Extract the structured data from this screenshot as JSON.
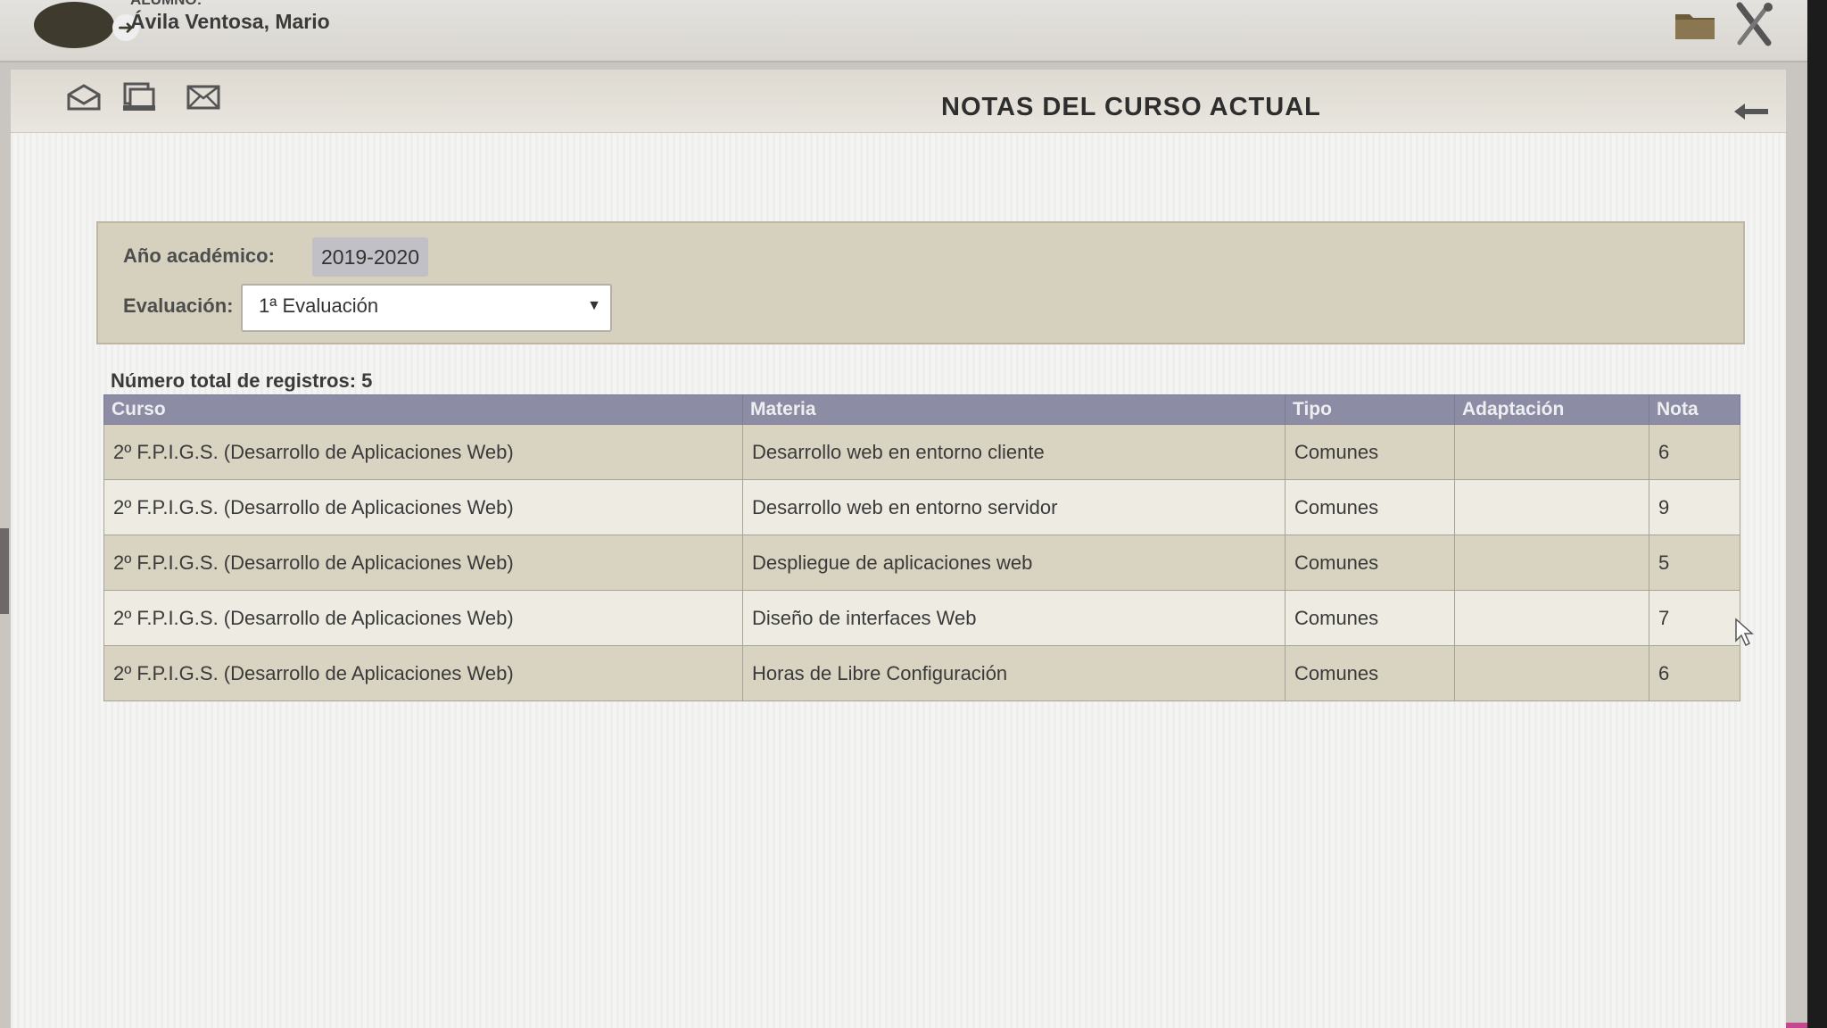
{
  "user": {
    "label": "ALUMNO:",
    "name": "Ávila Ventosa, Mario"
  },
  "header": {
    "title": "NOTAS DEL CURSO ACTUAL"
  },
  "filters": {
    "year_label": "Año académico:",
    "year_value": "2019-2020",
    "eval_label": "Evaluación:",
    "eval_value": "1ª Evaluación"
  },
  "records": {
    "count_label": "Número total de registros: 5"
  },
  "table": {
    "headers": [
      "Curso",
      "Materia",
      "Tipo",
      "Adaptación",
      "Nota"
    ],
    "rows": [
      {
        "curso": "2º F.P.I.G.S. (Desarrollo de Aplicaciones Web)",
        "materia": "Desarrollo web en entorno cliente",
        "tipo": "Comunes",
        "adaptacion": "",
        "nota": "6"
      },
      {
        "curso": "2º F.P.I.G.S. (Desarrollo de Aplicaciones Web)",
        "materia": "Desarrollo web en entorno servidor",
        "tipo": "Comunes",
        "adaptacion": "",
        "nota": "9"
      },
      {
        "curso": "2º F.P.I.G.S. (Desarrollo de Aplicaciones Web)",
        "materia": "Despliegue de aplicaciones web",
        "tipo": "Comunes",
        "adaptacion": "",
        "nota": "5"
      },
      {
        "curso": "2º F.P.I.G.S. (Desarrollo de Aplicaciones Web)",
        "materia": "Diseño de interfaces Web",
        "tipo": "Comunes",
        "adaptacion": "",
        "nota": "7"
      },
      {
        "curso": "2º F.P.I.G.S. (Desarrollo de Aplicaciones Web)",
        "materia": "Horas de Libre Configuración",
        "tipo": "Comunes",
        "adaptacion": "",
        "nota": "6"
      }
    ]
  },
  "colors": {
    "header_row": "#8c8da4",
    "odd_row": "#d9d3c1",
    "even_row": "#eeebe2",
    "filter_box": "#d6d0be"
  },
  "icons": [
    "logout-icon",
    "folder-icon",
    "tools-icon",
    "open-mail-icon",
    "print-icon",
    "mail-icon",
    "back-arrow-icon",
    "mouse-cursor-icon",
    "dropdown-caret-icon"
  ]
}
